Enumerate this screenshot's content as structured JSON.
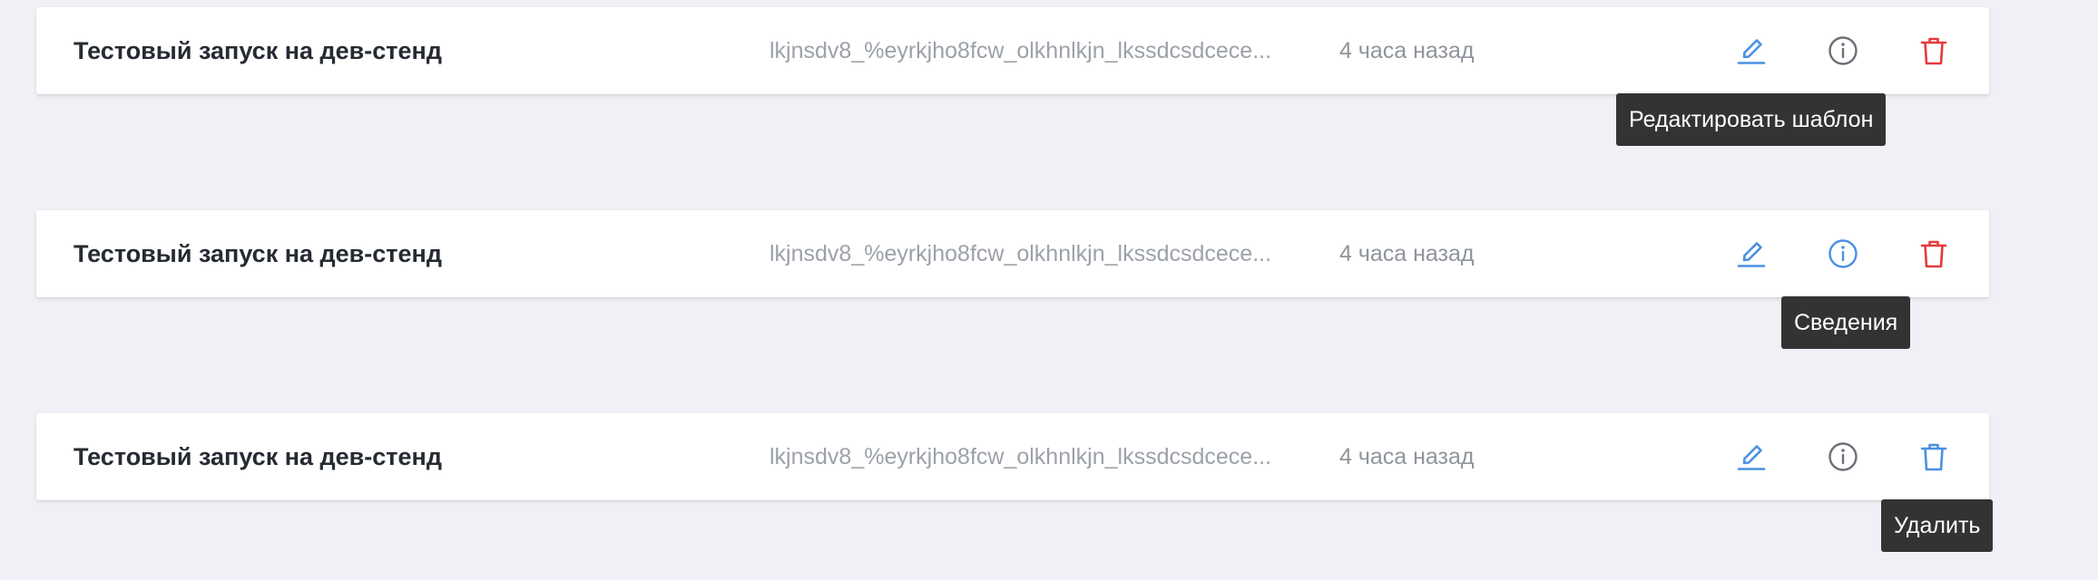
{
  "colors": {
    "background": "#eff1f6",
    "row_background": "#ffffff",
    "accent_blue": "#4a90e2",
    "danger_red": "#e5393f",
    "icon_gray": "#6b7078",
    "tooltip_background": "#333333"
  },
  "rows": [
    {
      "title": "Тестовый запуск на дев-стенд",
      "id_text": "lkjnsdv8_%eyrkjho8fcw_olkhnlkjn_lkssdcsdcece...",
      "time": "4 часа назад",
      "edit_icon": "pencil-icon",
      "info_icon": "info-circle-icon",
      "delete_icon": "trash-icon",
      "hovered": "edit",
      "tooltip": "Редактировать шаблон"
    },
    {
      "title": "Тестовый запуск на дев-стенд",
      "id_text": "lkjnsdv8_%eyrkjho8fcw_olkhnlkjn_lkssdcsdcece...",
      "time": "4 часа назад",
      "edit_icon": "pencil-icon",
      "info_icon": "info-circle-icon",
      "delete_icon": "trash-icon",
      "hovered": "info",
      "tooltip": "Сведения"
    },
    {
      "title": "Тестовый запуск на дев-стенд",
      "id_text": "lkjnsdv8_%eyrkjho8fcw_olkhnlkjn_lkssdcsdcece...",
      "time": "4 часа назад",
      "edit_icon": "pencil-icon",
      "info_icon": "info-circle-icon",
      "delete_icon": "trash-icon",
      "hovered": "delete",
      "tooltip": "Удалить"
    }
  ]
}
